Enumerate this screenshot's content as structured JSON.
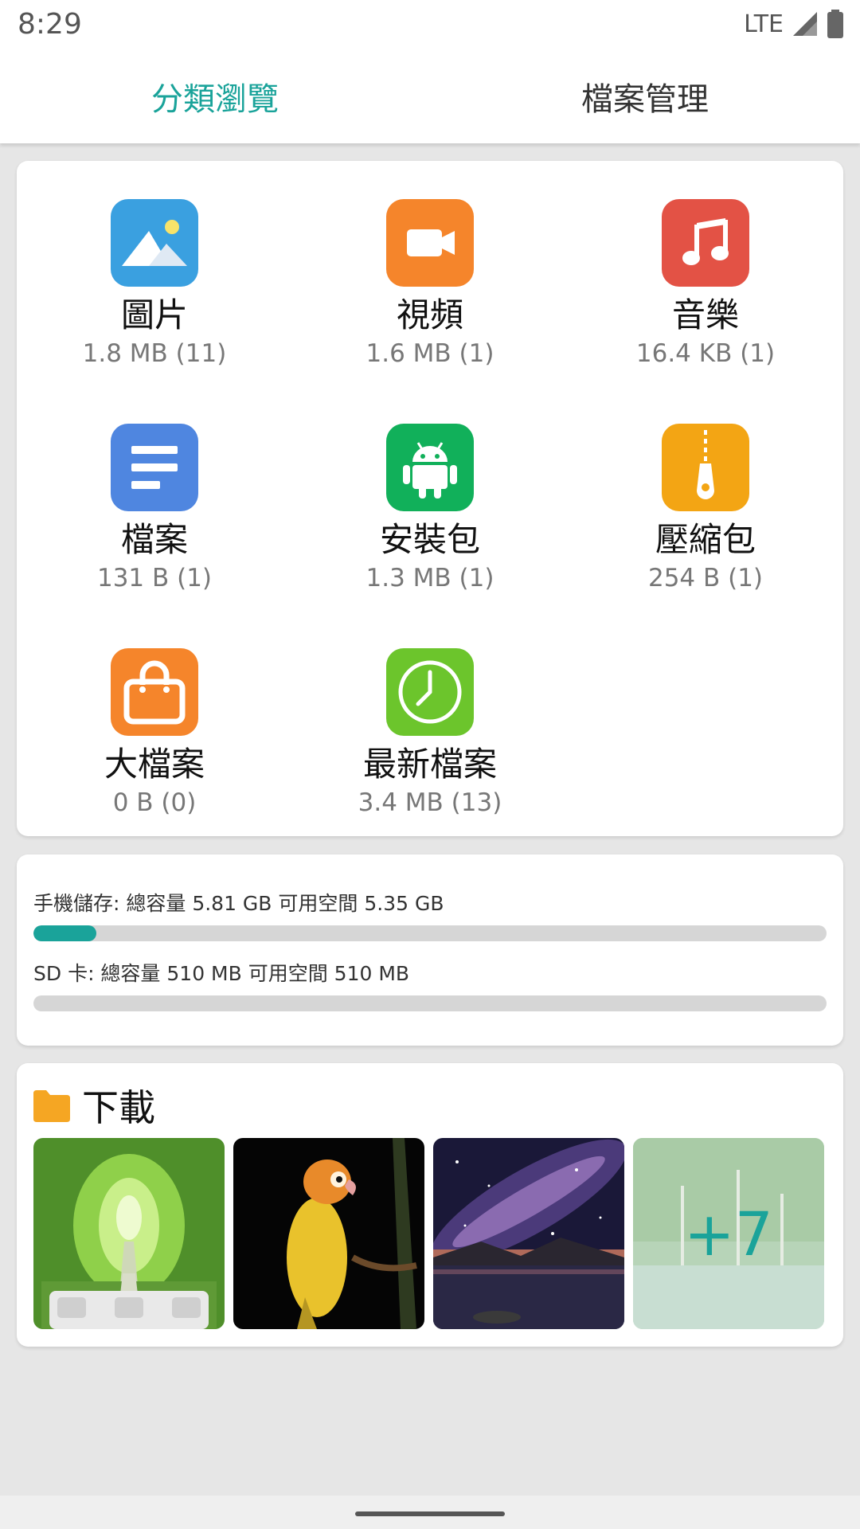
{
  "status": {
    "time": "8:29",
    "network": "LTE"
  },
  "tabs": [
    {
      "label": "分類瀏覽",
      "active": true
    },
    {
      "label": "檔案管理",
      "active": false
    }
  ],
  "categories": [
    {
      "label": "圖片",
      "size": "1.8 MB (11)",
      "icon": "image-icon",
      "color": "#3aa0e0"
    },
    {
      "label": "視頻",
      "size": "1.6 MB (1)",
      "icon": "video-icon",
      "color": "#f5852b"
    },
    {
      "label": "音樂",
      "size": "16.4 KB (1)",
      "icon": "music-icon",
      "color": "#e35245"
    },
    {
      "label": "檔案",
      "size": "131 B (1)",
      "icon": "document-icon",
      "color": "#4f86e0"
    },
    {
      "label": "安裝包",
      "size": "1.3 MB (1)",
      "icon": "android-icon",
      "color": "#11b05a"
    },
    {
      "label": "壓縮包",
      "size": "254 B (1)",
      "icon": "zip-icon",
      "color": "#f3a514"
    },
    {
      "label": "大檔案",
      "size": "0 B (0)",
      "icon": "bag-icon",
      "color": "#f5852b"
    },
    {
      "label": "最新檔案",
      "size": "3.4 MB (13)",
      "icon": "clock-icon",
      "color": "#6cc52c"
    }
  ],
  "storage": {
    "phone": {
      "text": "手機儲存: 總容量 5.81 GB  可用空間 5.35 GB",
      "used_fraction": 0.079
    },
    "sd": {
      "text": "SD 卡: 總容量 510 MB  可用空間 510 MB",
      "used_fraction": 0.0
    }
  },
  "downloads": {
    "title": "下載",
    "more_label": "+7"
  },
  "colors": {
    "accent": "#1aa39a",
    "folder": "#f5a623"
  }
}
